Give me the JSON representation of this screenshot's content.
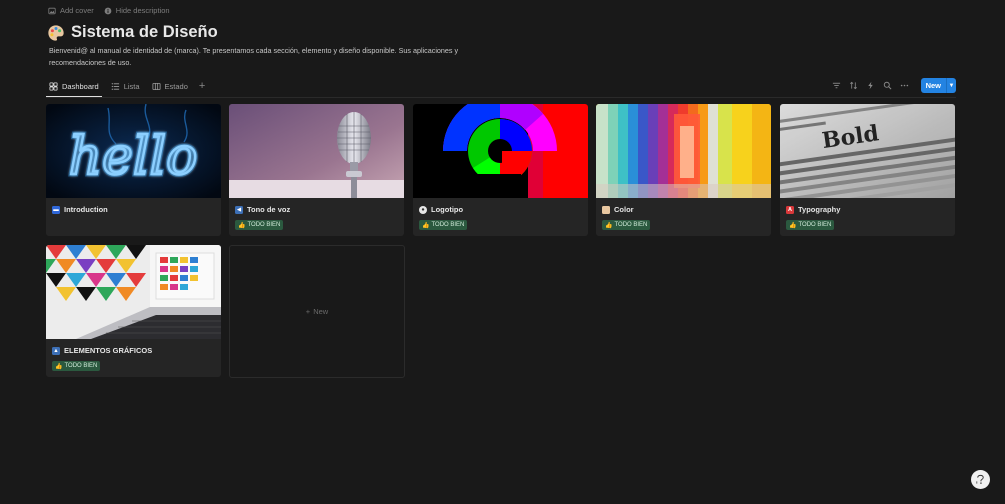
{
  "header": {
    "add_cover": "Add cover",
    "hide_description": "Hide description",
    "title": "Sistema de Diseño",
    "description": "Bienvenid@ al manual de identidad de (marca). Te presentamos cada sección, elemento y diseño disponible. Sus aplicaciones y recomendaciones de uso."
  },
  "views": {
    "tabs": [
      {
        "label": "Dashboard",
        "active": true
      },
      {
        "label": "Lista",
        "active": false
      },
      {
        "label": "Estado",
        "active": false
      }
    ],
    "add": "+",
    "new_button": "New"
  },
  "cards": [
    {
      "title": "Introduction",
      "badge": "",
      "image": "neon-hello",
      "image_text": "hello"
    },
    {
      "title": "Tono de voz",
      "badge": "TODO BIEN",
      "image": "microphone"
    },
    {
      "title": "Logotipo",
      "badge": "TODO BIEN",
      "image": "rgb-circles"
    },
    {
      "title": "Color",
      "badge": "TODO BIEN",
      "image": "color-corridor"
    },
    {
      "title": "Typography",
      "badge": "TODO BIEN",
      "image": "bold-book",
      "image_text": "Bold"
    },
    {
      "title": "ELEMENTOS GRÁFICOS",
      "badge": "TODO BIEN",
      "image": "laptop-graphics"
    }
  ],
  "new_card": "New",
  "colors": {
    "background": "#191919",
    "card": "#252525",
    "accent": "#2383e2",
    "badge_bg": "#2b593f",
    "neon": "#2ea7ff"
  },
  "icons": [
    "image-icon",
    "info-icon",
    "palette-icon",
    "grid-icon",
    "list-icon",
    "table-icon",
    "filter-icon",
    "sort-icon",
    "lightning-icon",
    "search-icon",
    "more-icon",
    "help-icon"
  ]
}
